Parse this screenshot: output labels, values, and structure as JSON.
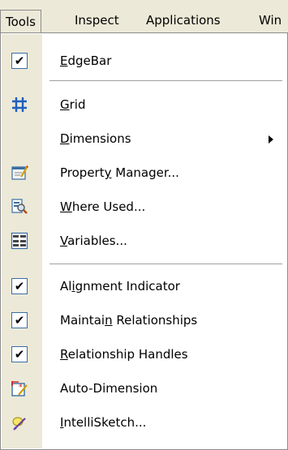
{
  "menubar": {
    "items": [
      "Tools",
      "Inspect",
      "Applications",
      "Win"
    ]
  },
  "menu": {
    "items": [
      {
        "label": "EdgeBar",
        "access": "E",
        "rest": "dgeBar",
        "icon": "checkbox-checked",
        "checked": true
      },
      {
        "label": "Grid",
        "access": "G",
        "rest": "rid",
        "icon": "grid-icon"
      },
      {
        "label": "Dimensions",
        "access": "D",
        "rest": "imensions",
        "submenu": true
      },
      {
        "label": "Property Manager...",
        "pre": "Propert",
        "access": "y",
        "rest": " Manager...",
        "icon": "property-manager-icon"
      },
      {
        "label": "Where Used...",
        "access": "W",
        "rest": "here Used...",
        "icon": "where-used-icon"
      },
      {
        "label": "Variables...",
        "access": "V",
        "rest": "ariables...",
        "icon": "variables-icon"
      },
      {
        "label": "Alignment Indicator",
        "pre": "Al",
        "access": "i",
        "rest": "gnment Indicator",
        "icon": "checkbox-checked",
        "checked": true
      },
      {
        "label": "Maintain Relationships",
        "pre": "Maintai",
        "access": "n",
        "rest": " Relationships",
        "icon": "checkbox-checked",
        "checked": true
      },
      {
        "label": "Relationship Handles",
        "access": "R",
        "rest": "elationship Handles",
        "icon": "checkbox-checked",
        "checked": true
      },
      {
        "label": "Auto-Dimension",
        "icon": "auto-dimension-icon"
      },
      {
        "label": "IntelliSketch...",
        "access": "I",
        "rest": "ntelliSketch...",
        "icon": "intellisketch-icon"
      }
    ],
    "check_mark": "✔"
  }
}
